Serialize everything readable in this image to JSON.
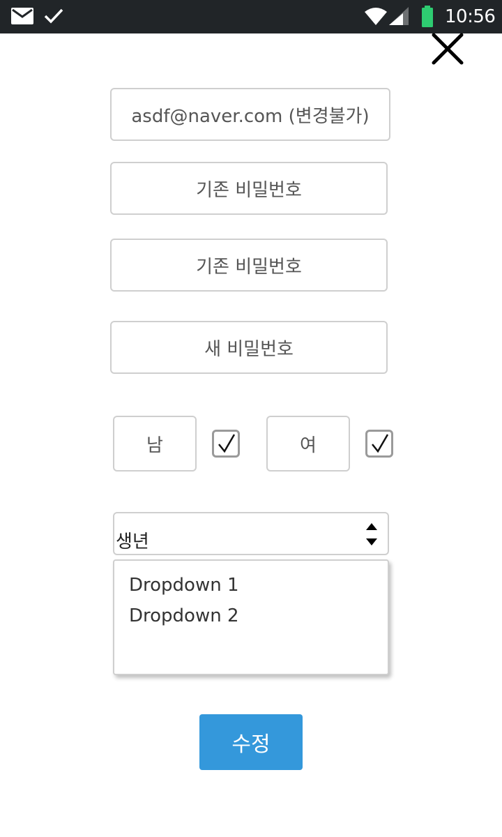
{
  "status_bar": {
    "time": "10:56",
    "icons": [
      "mail-icon",
      "check-icon",
      "wifi-icon",
      "signal-icon",
      "battery-icon"
    ],
    "battery_color": "#2ecc71",
    "background": "#212528"
  },
  "header": {
    "close_icon": "close-icon"
  },
  "form": {
    "email_text": "asdf@naver.com (변경불가)",
    "current_password_placeholder": "기존 비밀번호",
    "confirm_password_placeholder": "기존 비밀번호",
    "new_password_placeholder": "새 비밀번호",
    "gender": {
      "male_label": "남",
      "female_label": "여",
      "male_checked": true,
      "female_checked": true
    },
    "birth_year": {
      "selected": "생년",
      "options": [
        "Dropdown 1",
        "Dropdown 2"
      ]
    },
    "submit_label": "수정",
    "accent_color": "#3498db"
  }
}
